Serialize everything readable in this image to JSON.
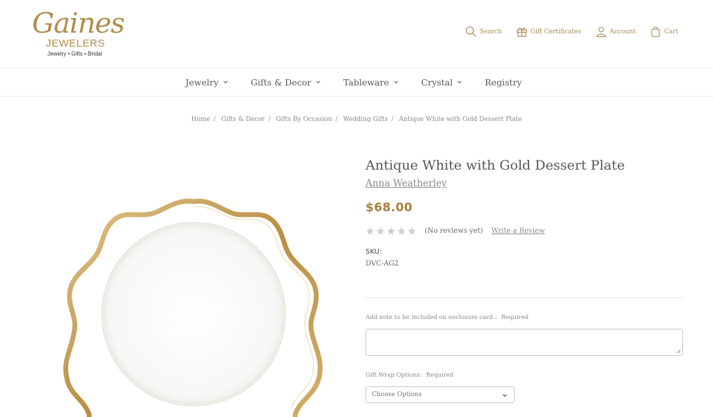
{
  "logo": {
    "script": "Gaines",
    "brand": "JEWELERS",
    "tagline": "Jewelry • Gifts • Bridal"
  },
  "utilities": [
    {
      "label": "Search",
      "icon": "search-icon"
    },
    {
      "label": "Gift Certificates",
      "icon": "gift-icon"
    },
    {
      "label": "Account",
      "icon": "user-icon"
    },
    {
      "label": "Cart",
      "icon": "bag-icon"
    }
  ],
  "nav": [
    {
      "label": "Jewelry",
      "has_dropdown": true
    },
    {
      "label": "Gifts & Decor",
      "has_dropdown": true
    },
    {
      "label": "Tableware",
      "has_dropdown": true
    },
    {
      "label": "Crystal",
      "has_dropdown": true
    },
    {
      "label": "Registry",
      "has_dropdown": false
    }
  ],
  "breadcrumb": [
    "Home",
    "Gifts & Decor",
    "Gifts By Occasion",
    "Wedding Gifts",
    "Antique White with Gold Dessert Plate"
  ],
  "product": {
    "title": "Antique White with Gold Dessert Plate",
    "brand": "Anna Weatherley",
    "price": "$68.00",
    "rating_stars": 0,
    "reviews_text": "(No reviews yet)",
    "write_review": "Write a Review",
    "sku_label": "SKU:",
    "sku_value": "DVC-AG2"
  },
  "form": {
    "note_label": "Add note to be included on enclosure card.:",
    "note_required": "Required",
    "note_value": "",
    "giftwrap_label": "Gift Wrap Options:",
    "giftwrap_required": "Required",
    "giftwrap_selected": "Choose Options"
  },
  "colors": {
    "gold": "#a7813d",
    "text": "#555555",
    "star_empty": "#cfcfcf"
  }
}
